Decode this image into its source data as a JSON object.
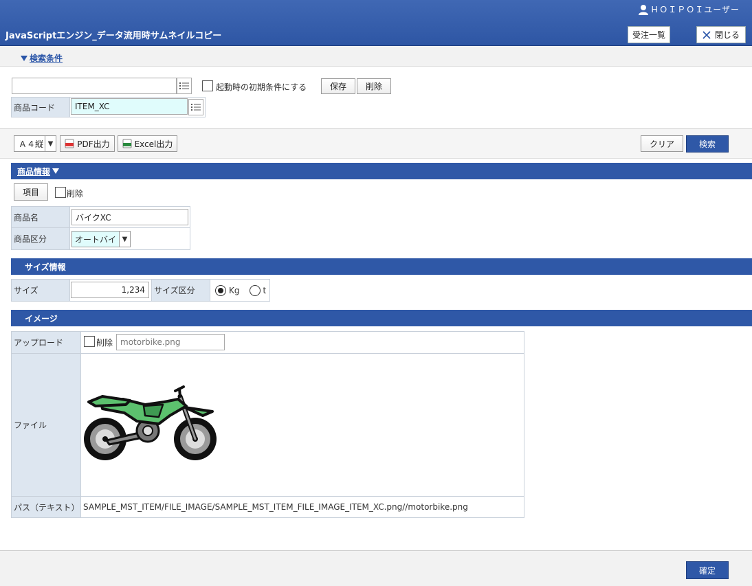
{
  "header": {
    "user_name": "ＨＯＩＰＯＩユーザー",
    "title": "JavaScriptエンジン_データ流用時サムネイルコピー",
    "order_list_label": "受注一覧",
    "close_label": "閉じる"
  },
  "search": {
    "toggle_label": "検索条件",
    "condition_name_value": "",
    "initial_condition_label": "起動時の初期条件にする",
    "save_label": "保存",
    "delete_label": "削除",
    "product_code_label": "商品コード",
    "product_code_value": "ITEM_XC"
  },
  "toolbar": {
    "paper_select_value": "Ａ４縦",
    "pdf_label": "PDF出力",
    "excel_label": "Excel出力",
    "clear_label": "クリア",
    "search_label": "検索"
  },
  "product_section": {
    "title": "商品情報",
    "item_button_label": "項目",
    "delete_label": "削除",
    "name_label": "商品名",
    "name_value": "バイクXC",
    "category_label": "商品区分",
    "category_value": "オートバイ"
  },
  "size_section": {
    "title": "サイズ情報",
    "size_label": "サイズ",
    "size_value": "1,234",
    "size_type_label": "サイズ区分",
    "option_kg": "Kg",
    "option_t": "t",
    "selected": "Kg"
  },
  "image_section": {
    "title": "イメージ",
    "upload_label": "アップロード",
    "delete_label": "削除",
    "upload_file_value": "motorbike.png",
    "file_label": "ファイル",
    "path_label": "パス（テキスト）",
    "path_value": "SAMPLE_MST_ITEM/FILE_IMAGE/SAMPLE_MST_ITEM_FILE_IMAGE_ITEM_XC.png//motorbike.png"
  },
  "footer": {
    "confirm_label": "確定"
  },
  "colors": {
    "header_blue": "#2f58a7",
    "label_cell_bg": "#dde6f0",
    "highlight_input_bg": "#e0fcfc",
    "bike_green": "#5cc16e"
  }
}
